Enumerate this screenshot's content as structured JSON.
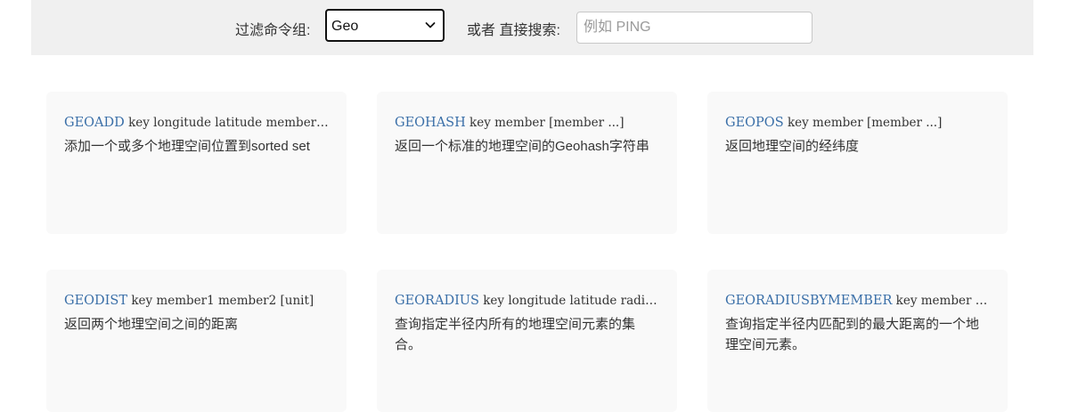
{
  "filter": {
    "group_label": "过滤命令组:",
    "group_selected": "Geo",
    "search_label": "或者 直接搜索:",
    "search_placeholder": "例如 PING",
    "search_value": ""
  },
  "commands": [
    {
      "name": "GEOADD",
      "args": "key longitude latitude member [longitude latitude member ...]",
      "desc": "添加一个或多个地理空间位置到sorted set"
    },
    {
      "name": "GEOHASH",
      "args": "key member [member ...]",
      "desc": "返回一个标准的地理空间的Geohash字符串"
    },
    {
      "name": "GEOPOS",
      "args": "key member [member ...]",
      "desc": "返回地理空间的经纬度"
    },
    {
      "name": "GEODIST",
      "args": "key member1 member2 [unit]",
      "desc": "返回两个地理空间之间的距离"
    },
    {
      "name": "GEORADIUS",
      "args": "key longitude latitude radius m|km|ft|mi [WITHCOORD] [WITHDIST] [WITHHASH] [COUNT count]",
      "desc": "查询指定半径内所有的地理空间元素的集合。"
    },
    {
      "name": "GEORADIUSBYMEMBER",
      "args": "key member radius m|km|ft|mi [WITHCOORD] [WITHDIST] [WITHHASH] [COUNT count]",
      "desc": "查询指定半径内匹配到的最大距离的一个地理空间元素。"
    }
  ]
}
